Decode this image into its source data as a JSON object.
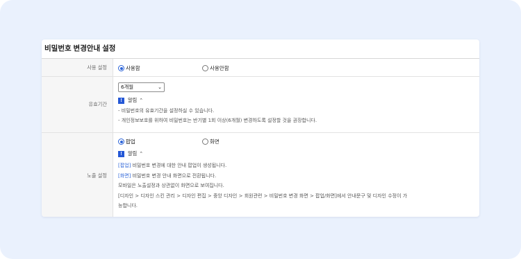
{
  "page": {
    "title": "비밀번호 변경안내 설정"
  },
  "rows": {
    "usage": {
      "label": "사용 설정",
      "options": [
        "사용함",
        "사용안함"
      ],
      "selected": 0
    },
    "period": {
      "label": "유효기간",
      "select_value": "6개월",
      "help_label": "알림",
      "help_icon": "!",
      "notes": [
        "- 비밀번호의 유효기간을 설정하실 수 있습니다.",
        "- 개인정보보호를 위하여 비밀번호는 반기별 1회 이상(6개월) 변경하도록 설정할 것을 권장합니다."
      ]
    },
    "display": {
      "label": "노출 설정",
      "options": [
        "팝업",
        "화면"
      ],
      "selected": 0,
      "help_label": "알림",
      "help_icon": "!",
      "notes": [
        {
          "tag": "[팝업]",
          "text": " 비밀번호 변경에 대한 안내 팝업이 생성됩니다."
        },
        {
          "tag": "[화면]",
          "text": " 비밀번호 변경 안내 화면으로 전환됩니다."
        },
        {
          "tag": "",
          "text": "모바일은 노출설정과 상관없이 화면으로 보여집니다."
        },
        {
          "tag": "",
          "text": "[디자인 > 디자인 스킨 관리 > 디자인 편집 > 중앙 디자인 > 회원관련 > 비밀번호 변경 화면 > 팝업/화면]에서 안내문구 및 디자인 수정이 가"
        },
        {
          "tag": "",
          "text": "능합니다."
        }
      ]
    }
  },
  "colors": {
    "accent": "#2c64d8",
    "badge": "#2558d6",
    "background": "#eaf1fd"
  }
}
